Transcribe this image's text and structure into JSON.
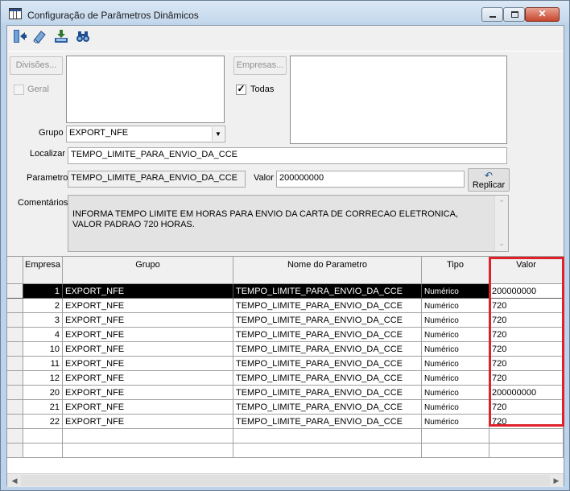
{
  "window": {
    "title": "Configuração de Parâmetros Dinâmicos",
    "controls": {
      "minimize": "minimize",
      "maximize": "maximize",
      "close": "✕"
    }
  },
  "toolbar": {
    "icons": [
      "exit-door-icon",
      "eraser-icon",
      "save-download-icon",
      "binoculars-search-icon"
    ]
  },
  "filters": {
    "divisoes_button": "Divisões...",
    "geral_label": "Geral",
    "geral_checked": false,
    "empresas_button": "Empresas...",
    "todas_label": "Todas",
    "todas_checked": true,
    "grupo_label": "Grupo",
    "grupo_value": "EXPORT_NFE",
    "localizar_label": "Localizar",
    "localizar_value": "TEMPO_LIMITE_PARA_ENVIO_DA_CCE"
  },
  "param": {
    "parametro_label": "Parametro",
    "parametro_value": "TEMPO_LIMITE_PARA_ENVIO_DA_CCE",
    "valor_label": "Valor",
    "valor_value": "200000000",
    "replicar_label": "Replicar",
    "comentarios_label": "Comentários",
    "comentarios_text": "INFORMA TEMPO LIMITE EM HORAS PARA ENVIO DA CARTA DE CORRECAO ELETRONICA,\nVALOR PADRAO 720 HORAS."
  },
  "grid": {
    "columns": [
      "Empresa",
      "Grupo",
      "Nome do Parametro",
      "Tipo",
      "Valor"
    ],
    "rows": [
      {
        "empresa": "1",
        "grupo": "EXPORT_NFE",
        "nome": "TEMPO_LIMITE_PARA_ENVIO_DA_CCE",
        "tipo": "Numérico",
        "valor": "200000000"
      },
      {
        "empresa": "2",
        "grupo": "EXPORT_NFE",
        "nome": "TEMPO_LIMITE_PARA_ENVIO_DA_CCE",
        "tipo": "Numérico",
        "valor": "720"
      },
      {
        "empresa": "3",
        "grupo": "EXPORT_NFE",
        "nome": "TEMPO_LIMITE_PARA_ENVIO_DA_CCE",
        "tipo": "Numérico",
        "valor": "720"
      },
      {
        "empresa": "4",
        "grupo": "EXPORT_NFE",
        "nome": "TEMPO_LIMITE_PARA_ENVIO_DA_CCE",
        "tipo": "Numérico",
        "valor": "720"
      },
      {
        "empresa": "10",
        "grupo": "EXPORT_NFE",
        "nome": "TEMPO_LIMITE_PARA_ENVIO_DA_CCE",
        "tipo": "Numérico",
        "valor": "720"
      },
      {
        "empresa": "11",
        "grupo": "EXPORT_NFE",
        "nome": "TEMPO_LIMITE_PARA_ENVIO_DA_CCE",
        "tipo": "Numérico",
        "valor": "720"
      },
      {
        "empresa": "12",
        "grupo": "EXPORT_NFE",
        "nome": "TEMPO_LIMITE_PARA_ENVIO_DA_CCE",
        "tipo": "Numérico",
        "valor": "720"
      },
      {
        "empresa": "20",
        "grupo": "EXPORT_NFE",
        "nome": "TEMPO_LIMITE_PARA_ENVIO_DA_CCE",
        "tipo": "Numérico",
        "valor": "200000000"
      },
      {
        "empresa": "21",
        "grupo": "EXPORT_NFE",
        "nome": "TEMPO_LIMITE_PARA_ENVIO_DA_CCE",
        "tipo": "Numérico",
        "valor": "720"
      },
      {
        "empresa": "22",
        "grupo": "EXPORT_NFE",
        "nome": "TEMPO_LIMITE_PARA_ENVIO_DA_CCE",
        "tipo": "Numérico",
        "valor": "720"
      }
    ]
  },
  "colors": {
    "highlight_border": "#e0202a",
    "selected_row": "#000000",
    "toolbar_icon": "#1f4f8f"
  }
}
